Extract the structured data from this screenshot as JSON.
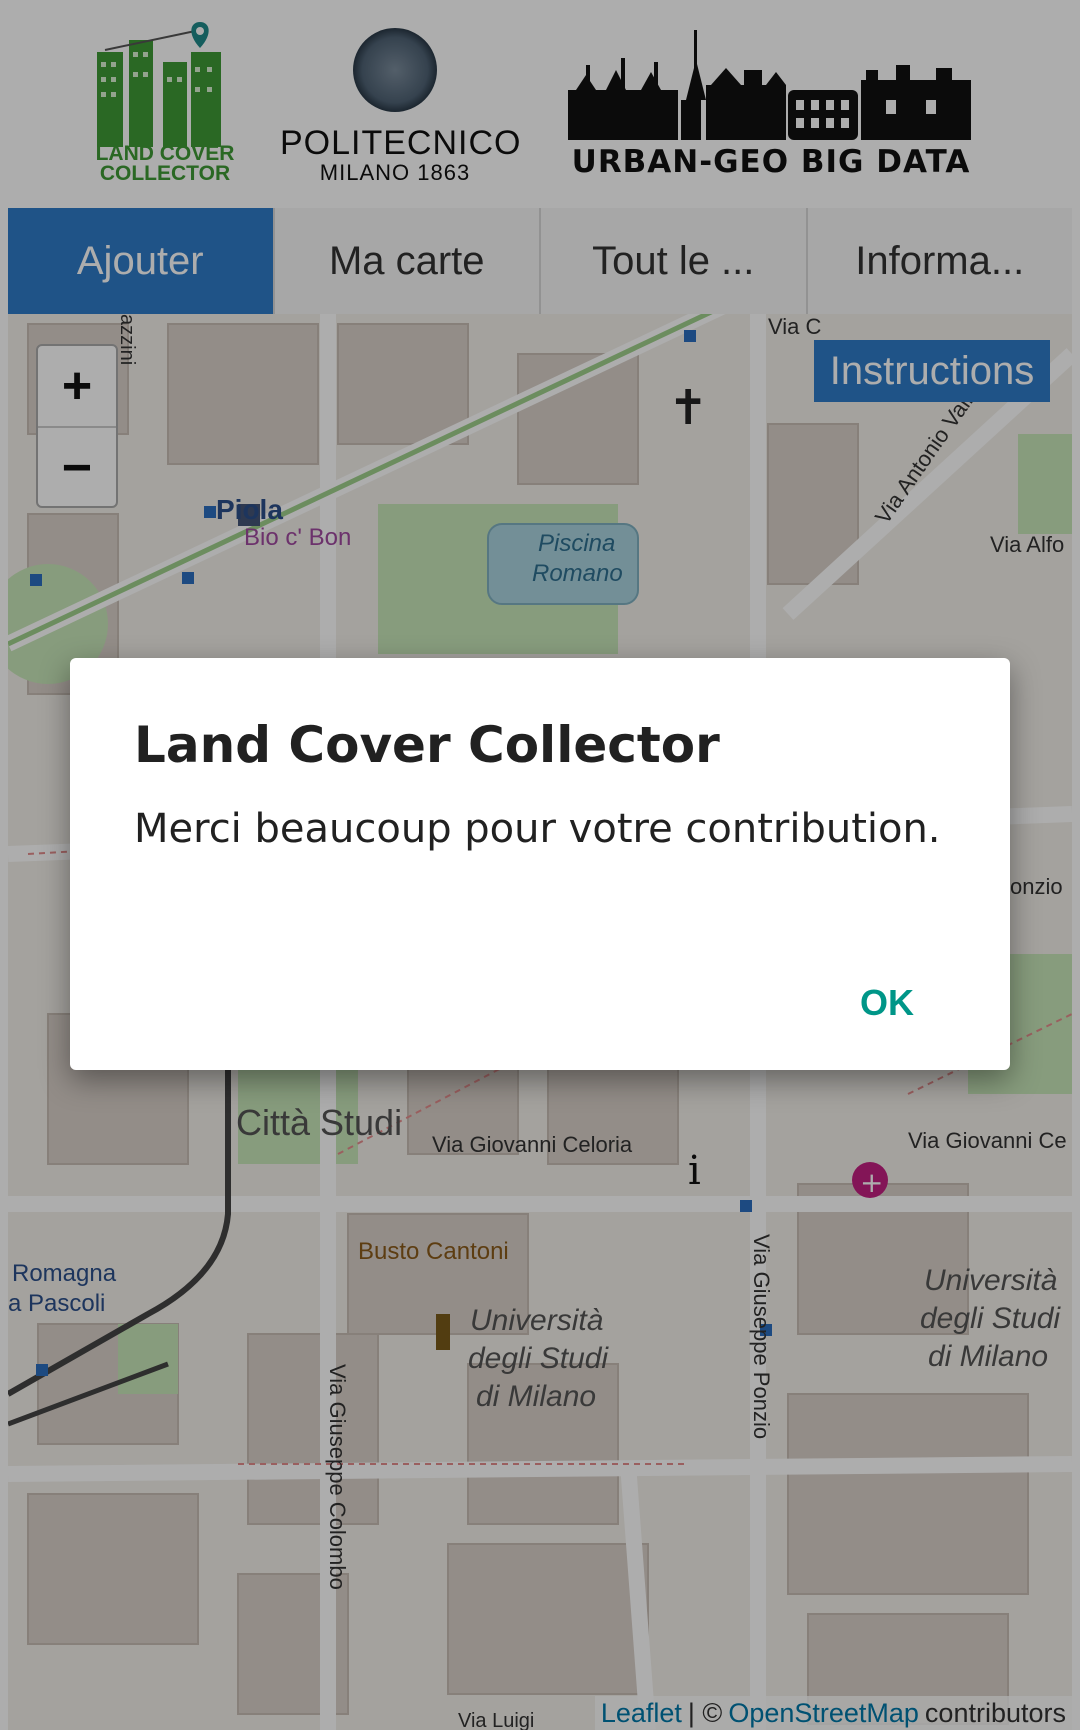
{
  "header": {
    "logo_lcc": {
      "line1": "LAND COVER",
      "line2": "COLLECTOR",
      "icon": "map-pin-icon"
    },
    "logo_poli": {
      "name": "POLITECNICO",
      "sub": "MILANO 1863",
      "icon": "university-seal-icon"
    },
    "logo_ugbd": {
      "name": "URBAN-GEO BIG DATA",
      "icon": "city-skyline-icon"
    }
  },
  "tabs": [
    {
      "label": "Ajouter",
      "active": true
    },
    {
      "label": "Ma carte",
      "active": false
    },
    {
      "label": "Tout le ...",
      "active": false
    },
    {
      "label": "Informa...",
      "active": false
    }
  ],
  "map": {
    "zoom_in": "+",
    "zoom_out": "−",
    "instructions": "Instructions",
    "labels": {
      "street_lazzarini": "azzini",
      "via_top": "Via C",
      "via_vallisneri": "Via Antonio Vallisneri",
      "via_alfo": "Via Alfo",
      "piola": "Piola",
      "bio_bon": "Bio c' Bon",
      "piscina": "Piscina",
      "romano": "Romano",
      "onzio": "onzio",
      "citta_studi": "Città Studi",
      "celoria": "Via Giovanni Celoria",
      "celoria_right": "Via Giovanni Ce",
      "romagna": "Romagna",
      "pascoli": "a Pascoli",
      "busto_cantoni": "Busto Cantoni",
      "colombo": "Via Giuseppe Colombo",
      "ponzio": "Via Giuseppe Ponzio",
      "unimi_center_1": "Università",
      "unimi_center_2": "degli Studi",
      "unimi_center_3": "di Milano",
      "unimi_right_1": "Università",
      "unimi_right_2": "degli Studi",
      "unimi_right_3": "di Milano",
      "via_luigi": "Via Luigi"
    },
    "attribution": {
      "leaflet": "Leaflet",
      "sep": "| ©",
      "osm": "OpenStreetMap",
      "contributors": "contributors"
    }
  },
  "dialog": {
    "title": "Land Cover Collector",
    "message": "Merci beaucoup pour votre contribution.",
    "ok": "OK"
  },
  "colors": {
    "accent_blue": "#2e7bc8",
    "ok_teal": "#009688",
    "logo_green": "#3f9a35"
  }
}
